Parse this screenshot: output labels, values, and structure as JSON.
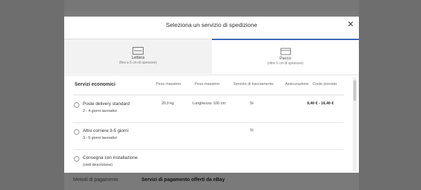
{
  "modal": {
    "title": "Seleziona un servizio di spedizione",
    "close_icon": "close-icon"
  },
  "tabs": [
    {
      "icon": "envelope-icon",
      "label": "Lettera",
      "desc": "(fino a 5 cm di spessore)",
      "selected": false
    },
    {
      "icon": "package-icon",
      "label": "Pacco",
      "desc": "(oltre 5 cm di spessore)",
      "selected": true
    }
  ],
  "table": {
    "section_title": "Servizi economici",
    "columns": {
      "peso_massimo": "Peso massimo",
      "peso_massimo_2": "Peso massimo",
      "tracciamento": "Servizio di tracciamento",
      "assicurazione": "Assicurazione",
      "costo": "Costo previsto"
    },
    "rows": [
      {
        "name": "Poste delivery standard",
        "sub": "2 - 4 giorni lavorativi",
        "weight": "20,0 kg",
        "size": "Lunghezza: 100 cm",
        "tracking": "Sì",
        "cost": "9,40 € - 16,40 €"
      },
      {
        "name": "Altro corriere 3-5 giorni",
        "sub": "3 - 5 giorni lavorativi",
        "weight": "",
        "size": "",
        "tracking": "Sì",
        "cost": ""
      },
      {
        "name": "Consegna con installazione",
        "sub": "(vedi descrizione)",
        "weight": "",
        "size": "",
        "tracking": "",
        "cost": ""
      }
    ]
  },
  "background": {
    "label": "Metodi di pagamento",
    "value": "Servizi di pagamento offerti da eBay"
  },
  "colors": {
    "accent": "#3665b3",
    "overlay": "#6e6e6e"
  }
}
